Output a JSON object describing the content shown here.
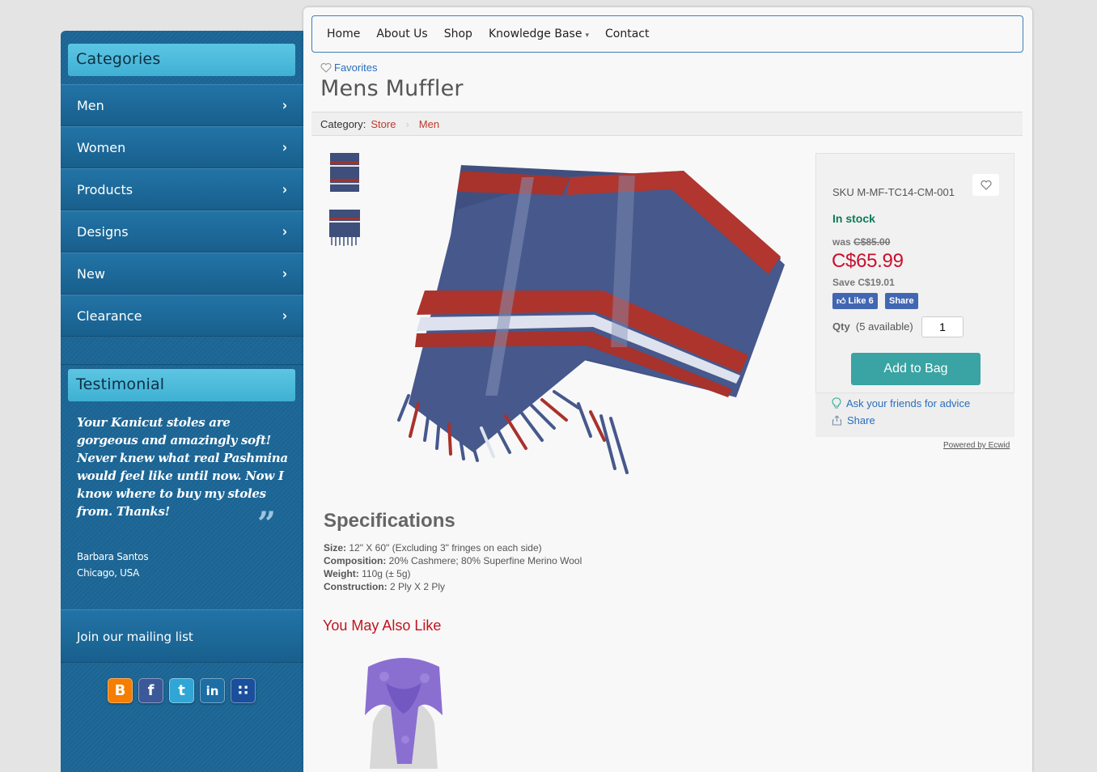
{
  "sidebar": {
    "categories_title": "Categories",
    "categories": [
      {
        "label": "Men"
      },
      {
        "label": "Women"
      },
      {
        "label": "Products"
      },
      {
        "label": "Designs"
      },
      {
        "label": "New"
      },
      {
        "label": "Clearance"
      }
    ],
    "testimonial_title": "Testimonial",
    "testimonial_text": "Your Kanicut stoles are gorgeous and amazingly soft! Never knew what real Pashmina would feel like until now. Now I know where to buy my stoles from. Thanks!",
    "testimonial_author": "Barbara Santos",
    "testimonial_location": "Chicago, USA",
    "mailing_label": "Join our mailing list",
    "social": [
      {
        "name": "blogger-icon",
        "glyph": "B",
        "color": "#f57d00"
      },
      {
        "name": "facebook-icon",
        "glyph": "f",
        "color": "#3b5998"
      },
      {
        "name": "twitter-icon",
        "glyph": "t",
        "color": "#2fa6d6"
      },
      {
        "name": "linkedin-icon",
        "glyph": "in",
        "color": "#1c6ea4"
      },
      {
        "name": "myspace-icon",
        "glyph": "m",
        "color": "#1a4f9c"
      }
    ]
  },
  "nav": {
    "home": "Home",
    "about": "About Us",
    "shop": "Shop",
    "kb": "Knowledge Base",
    "contact": "Contact"
  },
  "product": {
    "favorites": "Favorites",
    "title": "Mens Muffler",
    "category_label": "Category:",
    "breadcrumb": [
      "Store",
      "Men"
    ],
    "sku": "SKU M-MF-TC14-CM-001",
    "stock": "In stock",
    "was_label": "was",
    "was_price": "C$85.00",
    "price": "C$65.99",
    "save_label": "Save",
    "save_amount": "C$19.01",
    "fb_like": "Like 6",
    "fb_share": "Share",
    "qty_label": "Qty",
    "qty_available": "(5 available)",
    "qty_value": "1",
    "add_button": "Add to Bag",
    "ask_friends": "Ask your friends for advice",
    "share": "Share",
    "powered_by": "Powered by Ecwid"
  },
  "specs": {
    "title": "Specifications",
    "items": [
      {
        "key": "Size:",
        "value": "12\" X 60\" (Excluding 3\" fringes on each side)"
      },
      {
        "key": "Composition:",
        "value": "20% Cashmere; 80% Superfine Merino Wool"
      },
      {
        "key": "Weight:",
        "value": "110g (± 5g)"
      },
      {
        "key": "Construction:",
        "value": "2 Ply X 2 Ply"
      }
    ]
  },
  "related": {
    "title": "You May Also Like"
  },
  "colors": {
    "sidebar_blue": "#1f6a99",
    "header_cyan": "#4bbadc",
    "price_red": "#c8102e",
    "stock_green": "#0e7a5a",
    "button_teal": "#3aa3a3",
    "link_blue": "#2a6ebb"
  }
}
